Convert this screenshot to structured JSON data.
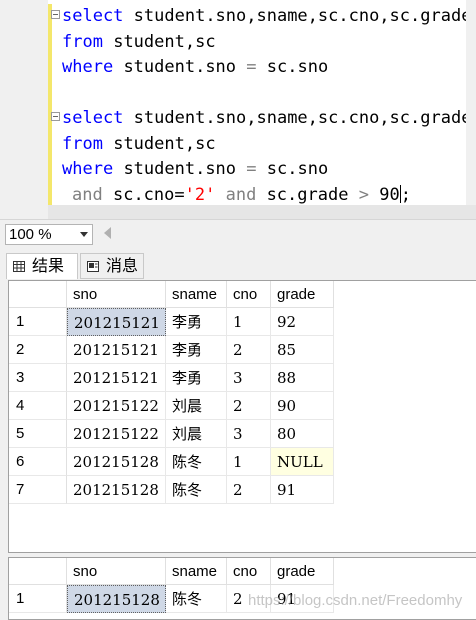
{
  "editor": {
    "query1": {
      "line1": [
        "select",
        "student.sno,sname,sc.cno,sc.grade"
      ],
      "line2": [
        "from",
        "student,sc"
      ],
      "line3": [
        "where",
        "student.sno",
        "=",
        "sc.sno"
      ]
    },
    "query2": {
      "line1": [
        "select",
        "student.sno,sname,sc.cno,sc.grade"
      ],
      "line2": [
        "from",
        "student,sc"
      ],
      "line3": [
        "where",
        "student.sno",
        "=",
        "sc.sno"
      ],
      "line4": [
        "and",
        "sc.cno=",
        "'2'",
        "and",
        "sc.grade",
        ">",
        "90",
        ";"
      ]
    },
    "colors": {
      "keyword": "#0000ff",
      "string": "#ff0000",
      "operator": "#808080",
      "current_line_bar": "#f4e76b"
    }
  },
  "zoom": {
    "value": "100 %"
  },
  "tabs": [
    {
      "label": "结果",
      "icon": "grid-icon"
    },
    {
      "label": "消息",
      "icon": "message-icon"
    }
  ],
  "result1": {
    "columns": [
      "sno",
      "sname",
      "cno",
      "grade"
    ],
    "rows": [
      {
        "n": "1",
        "sno": "201215121",
        "sname": "李勇",
        "cno": "1",
        "grade": "92"
      },
      {
        "n": "2",
        "sno": "201215121",
        "sname": "李勇",
        "cno": "2",
        "grade": "85"
      },
      {
        "n": "3",
        "sno": "201215121",
        "sname": "李勇",
        "cno": "3",
        "grade": "88"
      },
      {
        "n": "4",
        "sno": "201215122",
        "sname": "刘晨",
        "cno": "2",
        "grade": "90"
      },
      {
        "n": "5",
        "sno": "201215122",
        "sname": "刘晨",
        "cno": "3",
        "grade": "80"
      },
      {
        "n": "6",
        "sno": "201215128",
        "sname": "陈冬",
        "cno": "1",
        "grade": "NULL"
      },
      {
        "n": "7",
        "sno": "201215128",
        "sname": "陈冬",
        "cno": "2",
        "grade": "91"
      }
    ]
  },
  "result2": {
    "columns": [
      "sno",
      "sname",
      "cno",
      "grade"
    ],
    "rows": [
      {
        "n": "1",
        "sno": "201215128",
        "sname": "陈冬",
        "cno": "2",
        "grade": "91"
      }
    ]
  },
  "watermark": "https://blog.csdn.net/Freedomhy"
}
